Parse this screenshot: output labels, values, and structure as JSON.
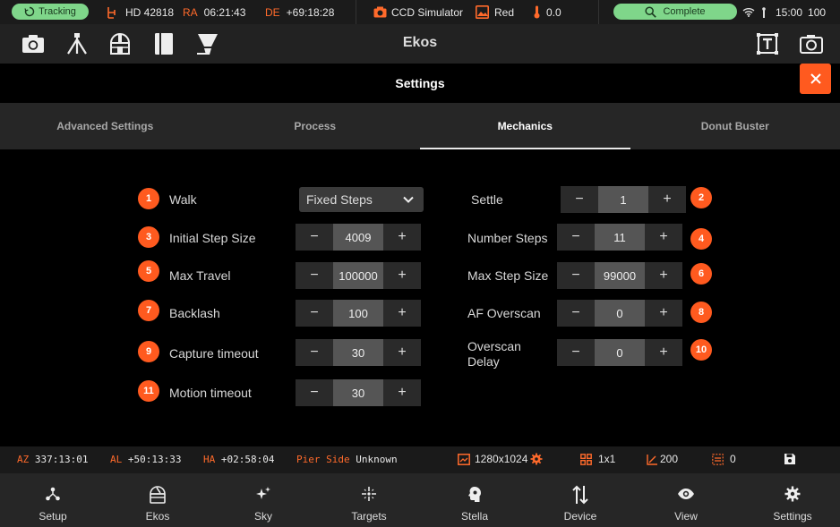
{
  "status": {
    "tracking": "Tracking",
    "target": "HD 42818",
    "ra_label": "RA",
    "ra": "06:21:43",
    "de_label": "DE",
    "de": "+69:18:28",
    "camera": "CCD Simulator",
    "filter": "Red",
    "temperature": "0.0",
    "complete": "Complete",
    "time": "15:00",
    "battery": "100"
  },
  "toolbar": {
    "title": "Ekos"
  },
  "settings": {
    "title": "Settings"
  },
  "tabs": [
    {
      "label": "Advanced Settings"
    },
    {
      "label": "Process"
    },
    {
      "label": "Mechanics"
    },
    {
      "label": "Donut Buster"
    }
  ],
  "fields": {
    "walk": {
      "num": "1",
      "label": "Walk",
      "value": "Fixed Steps"
    },
    "settle": {
      "num": "2",
      "label": "Settle",
      "value": "1"
    },
    "initial_step": {
      "num": "3",
      "label": "Initial Step Size",
      "value": "4009"
    },
    "number_steps": {
      "num": "4",
      "label": "Number Steps",
      "value": "11"
    },
    "max_travel": {
      "num": "5",
      "label": "Max Travel",
      "value": "100000"
    },
    "max_step": {
      "num": "6",
      "label": "Max Step Size",
      "value": "99000"
    },
    "backlash": {
      "num": "7",
      "label": "Backlash",
      "value": "100"
    },
    "af_overscan": {
      "num": "8",
      "label": "AF Overscan",
      "value": "0"
    },
    "capture_timeout": {
      "num": "9",
      "label": "Capture timeout",
      "value": "30"
    },
    "overscan_delay": {
      "num": "10",
      "label_line1": "Overscan",
      "label_line2": "Delay",
      "value": "0"
    },
    "motion_timeout": {
      "num": "11",
      "label": "Motion timeout",
      "value": "30"
    }
  },
  "stepper": {
    "minus": "−",
    "plus": "+"
  },
  "info": {
    "az_label": "AZ",
    "az": "337:13:01",
    "al_label": "AL",
    "al": "+50:13:33",
    "ha_label": "HA",
    "ha": "+02:58:04",
    "pier_label": "Pier Side",
    "pier": "Unknown",
    "resolution": "1280x1024",
    "binning": "1x1",
    "gain": "200",
    "offset": "0"
  },
  "nav": [
    {
      "label": "Setup"
    },
    {
      "label": "Ekos"
    },
    {
      "label": "Sky"
    },
    {
      "label": "Targets"
    },
    {
      "label": "Stella"
    },
    {
      "label": "Device"
    },
    {
      "label": "View"
    },
    {
      "label": "Settings"
    }
  ],
  "colors": {
    "accent": "#ff5a1f",
    "status_green": "#7fd68a",
    "bg": "#000000",
    "panel": "#262626"
  }
}
